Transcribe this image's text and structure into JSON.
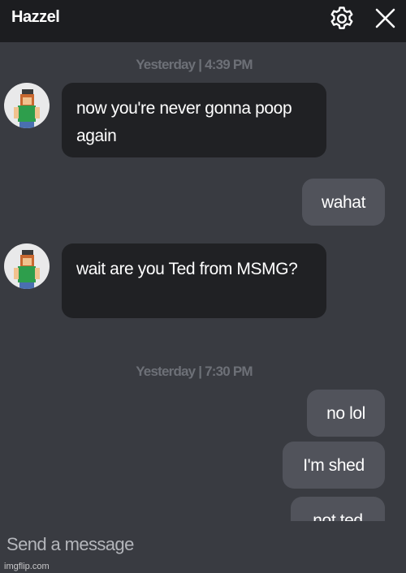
{
  "header": {
    "title": "Hazzel",
    "settings_icon": "gear-icon",
    "close_icon": "close-icon"
  },
  "messages": [
    {
      "type": "timestamp",
      "text": "Yesterday | 4:39 PM"
    },
    {
      "type": "incoming",
      "text": "now you're never gonna poop again"
    },
    {
      "type": "outgoing",
      "text": "wahat"
    },
    {
      "type": "incoming",
      "text": "wait are you Ted from MSMG?"
    },
    {
      "type": "timestamp",
      "text": "Yesterday | 7:30 PM"
    },
    {
      "type": "outgoing",
      "text": "no lol"
    },
    {
      "type": "outgoing",
      "text": "I'm shed"
    },
    {
      "type": "outgoing",
      "text": "not ted"
    }
  ],
  "composer": {
    "placeholder": "Send a message"
  },
  "watermark": "imgflip.com",
  "colors": {
    "header_bg": "#1c1d20",
    "chat_bg": "#393b41",
    "incoming_bubble": "#202124",
    "outgoing_bubble": "#51535b",
    "timestamp_text": "#6d7077"
  }
}
